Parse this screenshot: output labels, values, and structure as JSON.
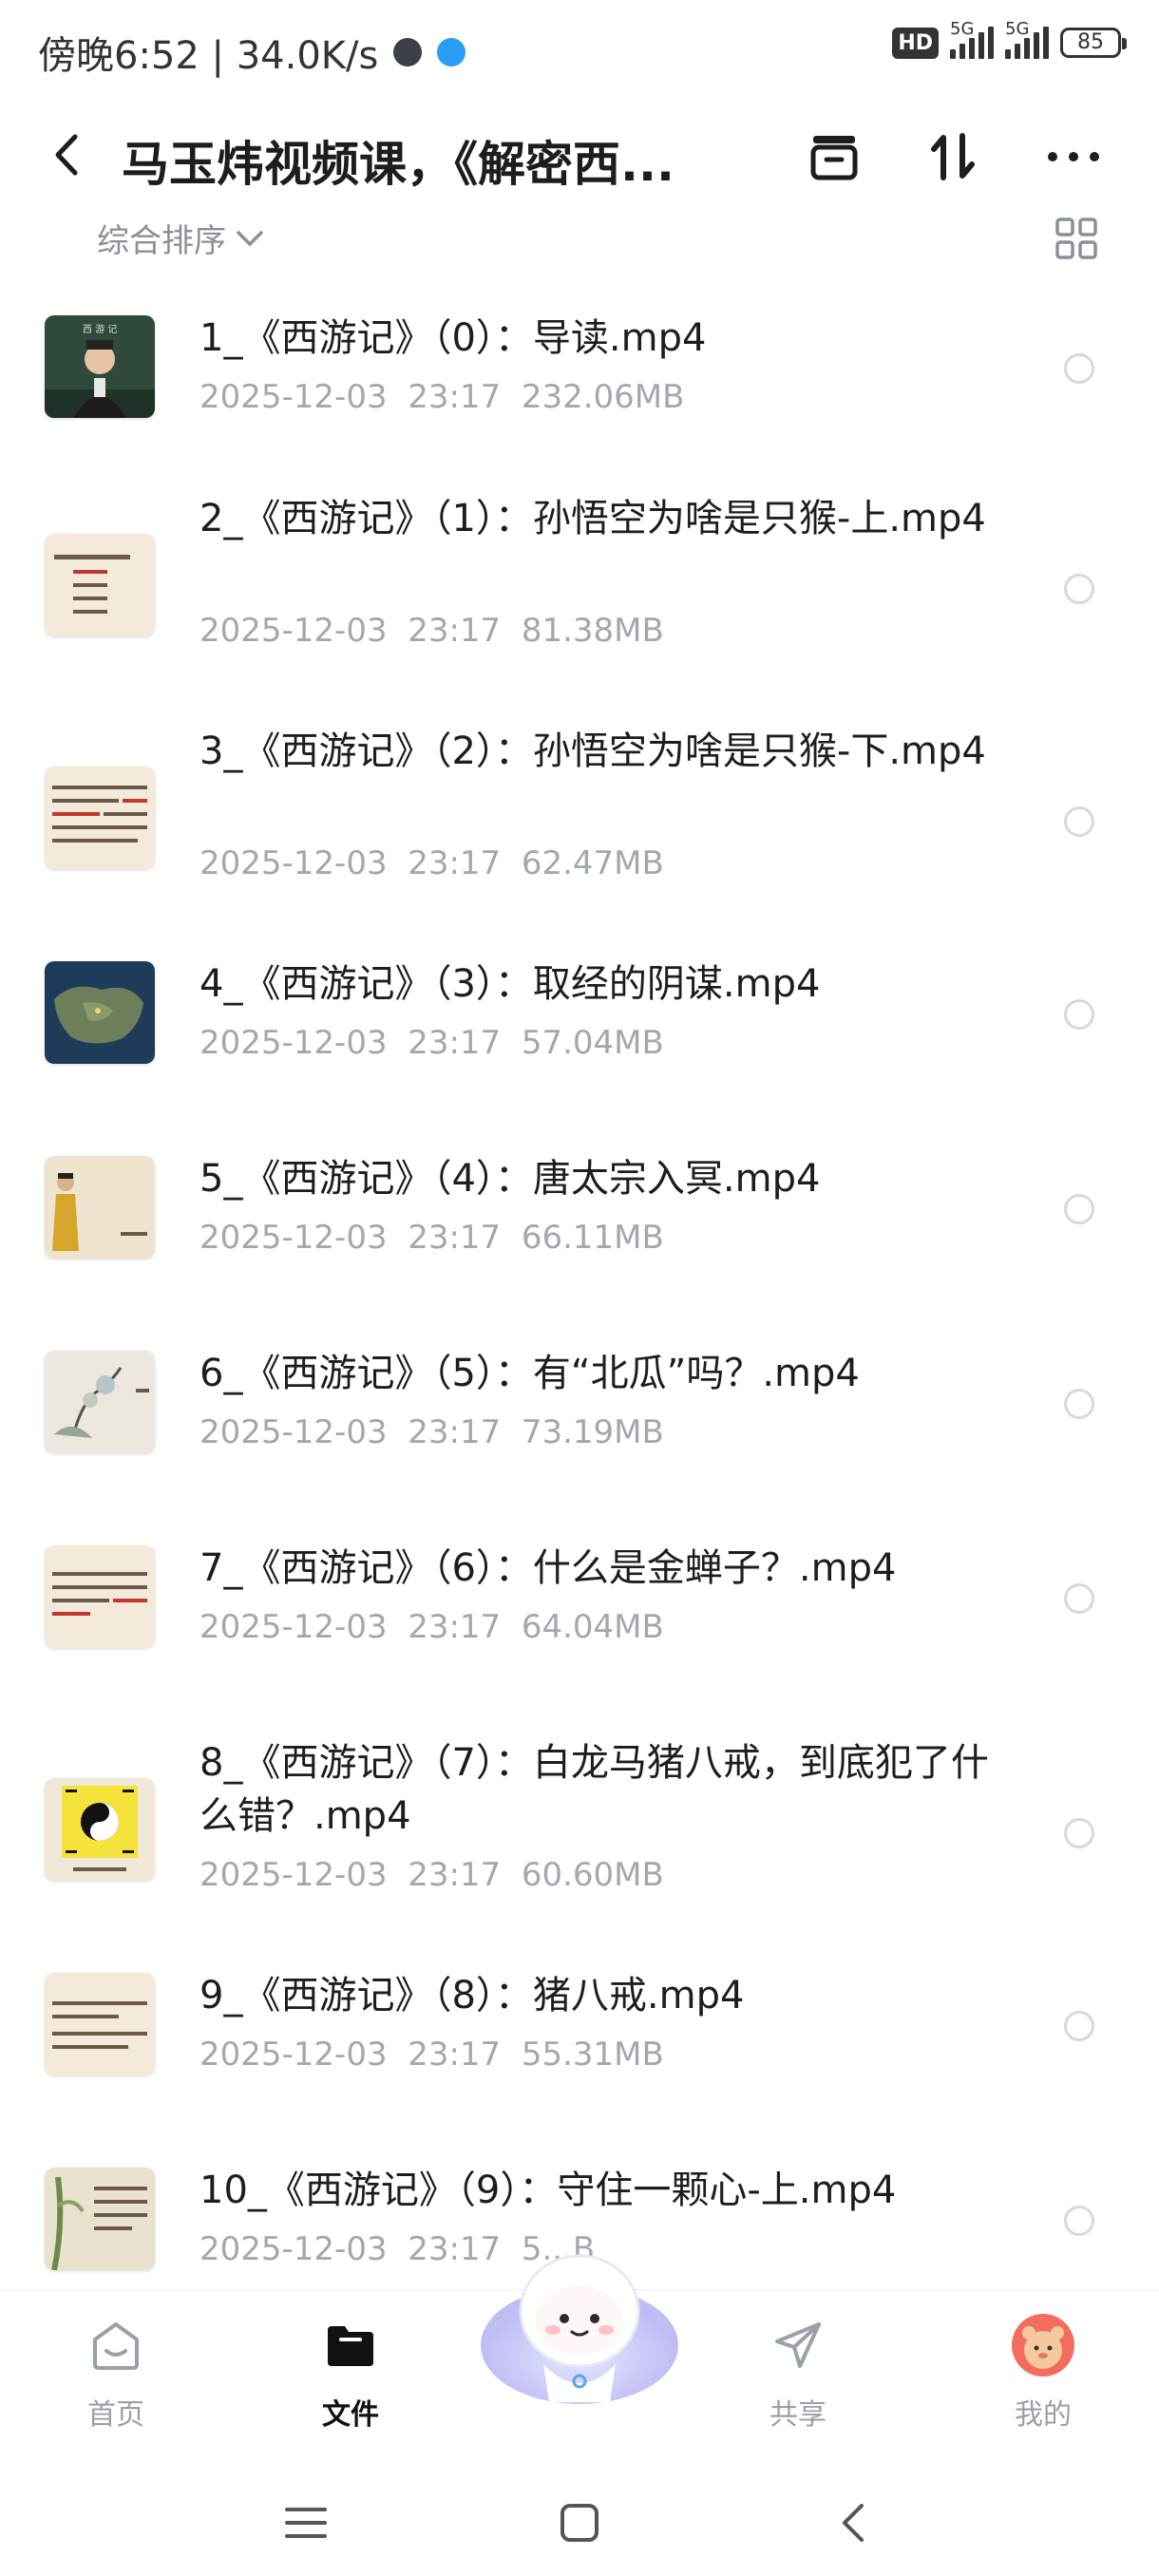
{
  "status_bar": {
    "time_speed": "傍晚6:52 | 34.0K/s",
    "hd_label": "HD",
    "network_1": "5G",
    "network_2": "5G",
    "battery": "85"
  },
  "header": {
    "title": "马玉炜视频课，《解密西...",
    "icons": [
      "back-icon",
      "archive-icon",
      "sort-icon",
      "more-icon"
    ]
  },
  "sort": {
    "label": "综合排序",
    "view_toggle_icon": "grid-icon"
  },
  "files": [
    {
      "name": "1_《西游记》（0）：导读.mp4",
      "date": "2025-12-03  23:17",
      "size": "232.06MB",
      "thumb": "teacher-video-thumb"
    },
    {
      "name": "2_《西游记》（1）：孙悟空为啥是只猴-上.mp4",
      "date": "2025-12-03  23:17",
      "size": "81.38MB",
      "thumb": "slide-thumb"
    },
    {
      "name": "3_《西游记》（2）：孙悟空为啥是只猴-下.mp4",
      "date": "2025-12-03  23:17",
      "size": "62.47MB",
      "thumb": "slide-thumb"
    },
    {
      "name": "4_《西游记》（3）：取经的阴谋.mp4",
      "date": "2025-12-03  23:17",
      "size": "57.04MB",
      "thumb": "map-thumb"
    },
    {
      "name": "5_《西游记》（4）：唐太宗入冥.mp4",
      "date": "2025-12-03  23:17",
      "size": "66.11MB",
      "thumb": "emperor-thumb"
    },
    {
      "name": "6_《西游记》（5）：有“北瓜”吗？.mp4",
      "date": "2025-12-03  23:17",
      "size": "73.19MB",
      "thumb": "painting-thumb"
    },
    {
      "name": "7_《西游记》（6）：什么是金蝉子？.mp4",
      "date": "2025-12-03  23:17",
      "size": "64.04MB",
      "thumb": "slide-thumb"
    },
    {
      "name": "8_《西游记》（7）：白龙马猪八戒，到底犯了什么错？.mp4",
      "date": "2025-12-03  23:17",
      "size": "60.60MB",
      "thumb": "bagua-thumb"
    },
    {
      "name": "9_《西游记》（8）：猪八戒.mp4",
      "date": "2025-12-03  23:17",
      "size": "55.31MB",
      "thumb": "slide-thumb"
    },
    {
      "name": "10_《西游记》（9）：守住一颗心-上.mp4",
      "date": "2025-12-03  23:17",
      "size": "5...B",
      "thumb": "bamboo-thumb"
    }
  ],
  "bottom_nav": {
    "tabs": [
      {
        "label": "首页",
        "icon": "home-icon",
        "active": false
      },
      {
        "label": "文件",
        "icon": "folder-icon",
        "active": true
      },
      {
        "label": "共享",
        "icon": "share-icon",
        "active": false
      },
      {
        "label": "我的",
        "icon": "avatar-icon",
        "active": false
      }
    ],
    "center_icon": "assistant-mascot-icon"
  },
  "system_nav": [
    "menu-icon",
    "home-square-icon",
    "back-arrow-icon"
  ],
  "colors": {
    "text_primary": "#1d1d1f",
    "text_secondary": "#a3a8b0",
    "sort_label": "#8a8f99",
    "radio_border": "#d6d9de"
  }
}
